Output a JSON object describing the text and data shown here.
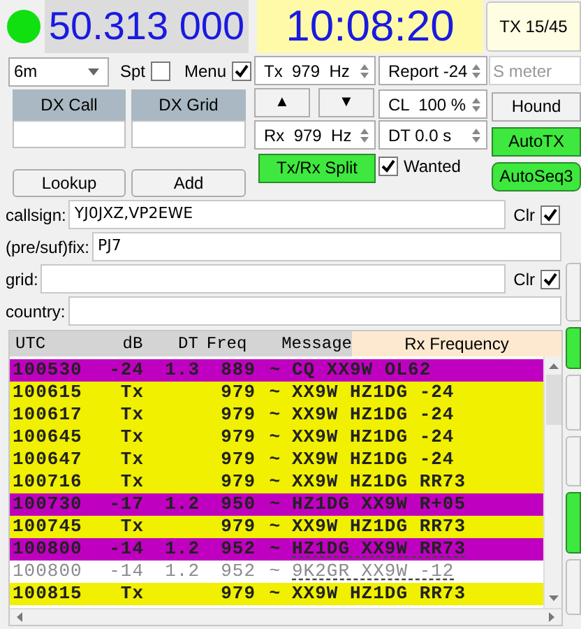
{
  "frequency": "50.313 000",
  "clock": "10:08:20",
  "tx_period_button": "TX 15/45",
  "band": {
    "value": "6m"
  },
  "spot": {
    "label": "Spt",
    "checked": false
  },
  "menu": {
    "label": "Menu",
    "checked": true
  },
  "tx_freq": "Tx  979  Hz",
  "report": "Report -24",
  "s_meter": {
    "placeholder": "S meter"
  },
  "dx_call": {
    "label": "DX Call"
  },
  "dx_grid": {
    "label": "DX Grid"
  },
  "up_button": "▲",
  "down_button": "▼",
  "cl": "CL  100 %",
  "hound": {
    "label": "Hound",
    "on": false
  },
  "rx_freq": "Rx  979  Hz",
  "dt": "DT 0.0 s",
  "auto_tx": {
    "label": "AutoTX",
    "on": true
  },
  "split": {
    "label": "Tx/Rx Split",
    "on": true
  },
  "wanted": {
    "label": "Wanted",
    "checked": true
  },
  "autoseq": {
    "label": "AutoSeq3",
    "on": true
  },
  "lookup_button": "Lookup",
  "add_button": "Add",
  "filters": [
    {
      "label": "callsign:",
      "value": "YJ0JXZ,VP2EWE",
      "clear": {
        "label": "Clr",
        "checked": true
      }
    },
    {
      "label": "(pre/suf)fix:",
      "value": "PJ7"
    },
    {
      "label": "grid:",
      "clear": {
        "label": "Clr",
        "checked": true
      }
    },
    {
      "label": "country:"
    }
  ],
  "table": {
    "columns": [
      "UTC",
      "dB",
      "DT",
      "Freq",
      "Message"
    ],
    "title": "Rx Frequency",
    "rows": [
      {
        "utc": "100530",
        "db": "-24",
        "dt": "1.3",
        "freq": "889",
        "mode": "~",
        "message": "CQ XX9W OL62",
        "color": "#c000c0",
        "dimmed": false,
        "underlined": false
      },
      {
        "utc": "100615",
        "db": "Tx",
        "freq": "979",
        "mode": "~",
        "message": "XX9W HZ1DG -24",
        "color": "#f0f000",
        "dimmed": false,
        "underlined": false
      },
      {
        "utc": "100617",
        "db": "Tx",
        "freq": "979",
        "mode": "~",
        "message": "XX9W HZ1DG -24",
        "color": "#f0f000",
        "dimmed": false,
        "underlined": false
      },
      {
        "utc": "100645",
        "db": "Tx",
        "freq": "979",
        "mode": "~",
        "message": "XX9W HZ1DG -24",
        "color": "#f0f000",
        "dimmed": false,
        "underlined": false
      },
      {
        "utc": "100647",
        "db": "Tx",
        "freq": "979",
        "mode": "~",
        "message": "XX9W HZ1DG -24",
        "color": "#f0f000",
        "dimmed": false,
        "underlined": false
      },
      {
        "utc": "100716",
        "db": "Tx",
        "freq": "979",
        "mode": "~",
        "message": "XX9W HZ1DG RR73",
        "color": "#f0f000",
        "dimmed": false,
        "underlined": false
      },
      {
        "utc": "100730",
        "db": "-17",
        "dt": "1.2",
        "freq": "950",
        "mode": "~",
        "message": "HZ1DG XX9W R+05",
        "color": "#c000c0",
        "dimmed": false,
        "underlined": false
      },
      {
        "utc": "100745",
        "db": "Tx",
        "freq": "979",
        "mode": "~",
        "message": "XX9W HZ1DG RR73",
        "color": "#f0f000",
        "dimmed": false,
        "underlined": false
      },
      {
        "utc": "100800",
        "db": "-14",
        "dt": "1.2",
        "freq": "952",
        "mode": "~",
        "message": "HZ1DG XX9W RR73",
        "color": "#c000c0",
        "dimmed": false,
        "underlined": true
      },
      {
        "utc": "100800",
        "db": "-14",
        "dt": "1.2",
        "freq": "952",
        "mode": "~",
        "message": "9K2GR XX9W -12",
        "color": "#ffffff",
        "dimmed": true,
        "underlined": true
      },
      {
        "utc": "100815",
        "db": "Tx",
        "freq": "979",
        "mode": "~",
        "message": "XX9W HZ1DG RR73",
        "color": "#f0f000",
        "dimmed": false,
        "underlined": false
      }
    ]
  }
}
